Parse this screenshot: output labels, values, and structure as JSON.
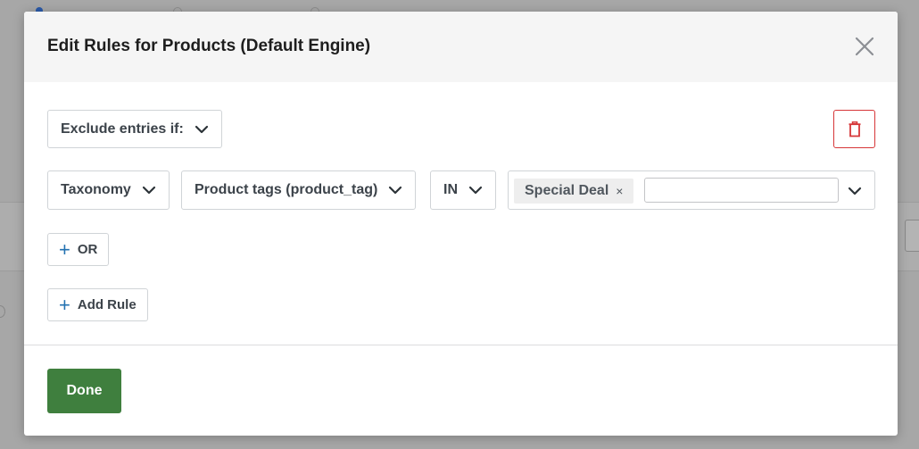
{
  "modal": {
    "title": "Edit Rules for Products (Default Engine)",
    "close_icon": "close-icon"
  },
  "rule_group": {
    "condition_label": "Exclude entries if:",
    "delete_icon": "trash-icon",
    "delete_color": "#d63638"
  },
  "rule": {
    "type_label": "Taxonomy",
    "taxonomy_label": "Product tags (product_tag)",
    "operator_label": "IN",
    "selected_tags": [
      "Special Deal"
    ],
    "tag_remove_glyph": "×",
    "search_value": ""
  },
  "actions": {
    "or_label": "OR",
    "add_rule_label": "Add Rule",
    "done_label": "Done",
    "plus_glyph": "+",
    "accent_color": "#2271b1",
    "done_color": "#3f7f3e"
  }
}
